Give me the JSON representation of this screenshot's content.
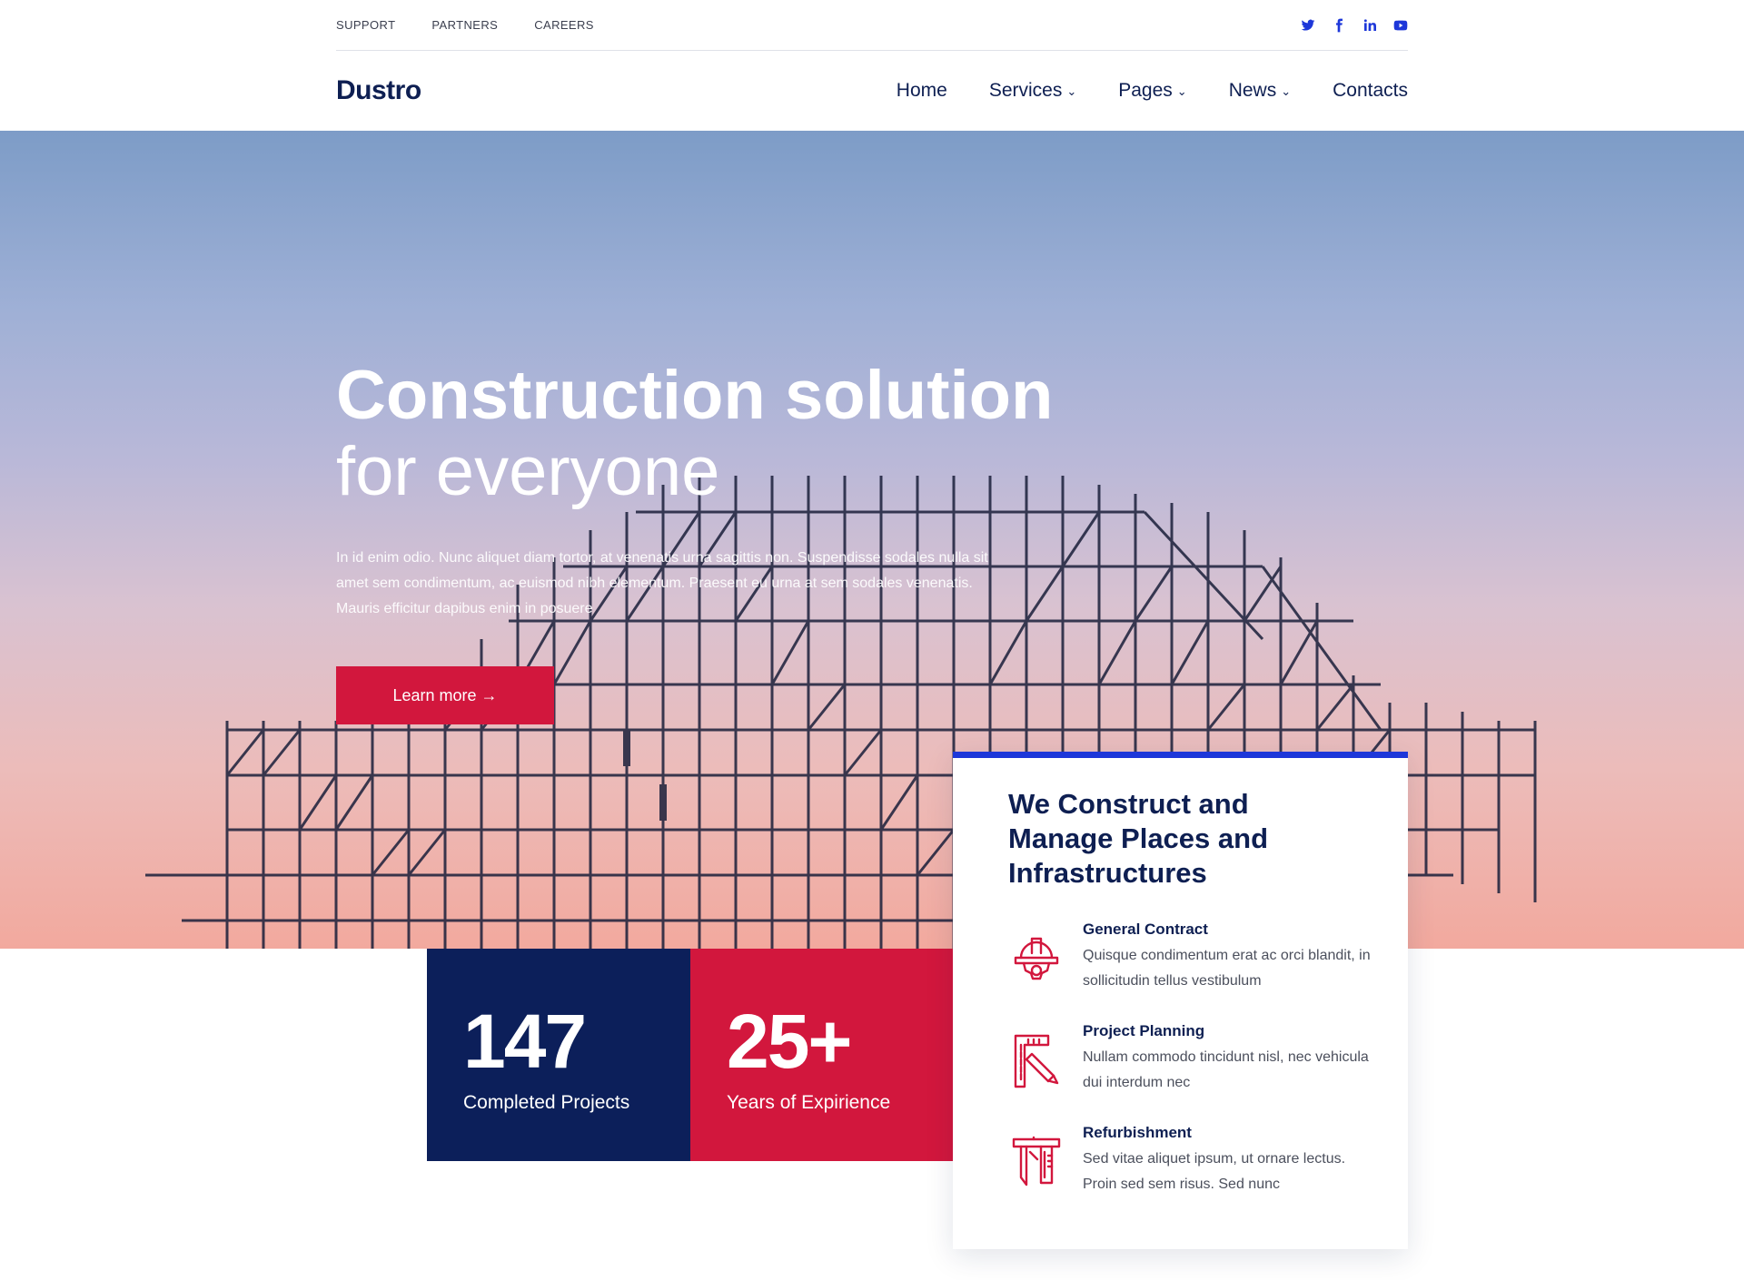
{
  "topbar": {
    "links": [
      "SUPPORT",
      "PARTNERS",
      "CAREERS"
    ],
    "social": [
      "twitter-icon",
      "facebook-icon",
      "linkedin-icon",
      "youtube-icon"
    ]
  },
  "nav": {
    "logo": "Dustro",
    "items": [
      "Home",
      "Services",
      "Pages",
      "News",
      "Contacts"
    ]
  },
  "hero": {
    "title_line1": "Construction solution",
    "title_line2": "for everyone",
    "text": "In id enim odio. Nunc aliquet diam tortor, at venenatis urna sagittis non. Suspendisse sodales nulla sit amet sem condimentum, ac euismod nibh elementum. Praesent eu urna at sem sodales venenatis. Mauris efficitur dapibus enim in posuere",
    "button": "Learn more →"
  },
  "stats": [
    {
      "value": "147",
      "label": "Completed Projects"
    },
    {
      "value": "25+",
      "label": "Years of Expirience"
    }
  ],
  "card": {
    "title": "We Construct and Manage Places and Infrastructures",
    "services": [
      {
        "name": "General Contract",
        "desc": "Quisque condimentum erat ac orci blandit, in sollicitudin tellus vestibulum",
        "icon": "hardhat-gear-icon"
      },
      {
        "name": "Project Planning",
        "desc": "Nullam commodo tincidunt nisl, nec vehicula dui interdum nec",
        "icon": "ruler-pencil-icon"
      },
      {
        "name": "Refurbishment",
        "desc": "Sed vitae aliquet ipsum, ut ornare lectus. Proin sed sem risus. Sed nunc",
        "icon": "caliper-icon"
      }
    ]
  },
  "colors": {
    "navy": "#0c1f5a",
    "red": "#d2173d",
    "blue": "#1d37d9"
  }
}
